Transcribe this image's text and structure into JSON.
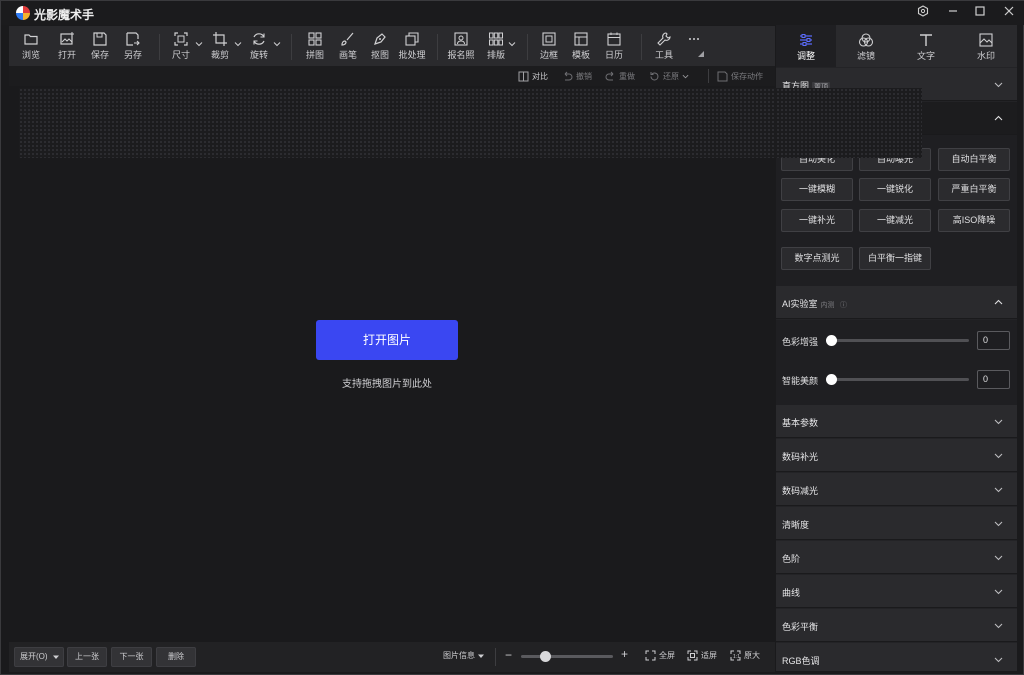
{
  "app": {
    "title": "光影魔术手"
  },
  "toolbar": {
    "browse": "浏览",
    "open": "打开",
    "save": "保存",
    "save_as": "另存",
    "size": "尺寸",
    "crop": "裁剪",
    "rotate": "旋转",
    "collage": "拼图",
    "brush": "画笔",
    "cutout": "抠图",
    "batch": "批处理",
    "id_photo": "报名照",
    "layout": "排版",
    "border": "边框",
    "template": "模板",
    "calendar": "日历",
    "tools": "工具"
  },
  "subbar": {
    "compare": "对比",
    "undo": "撤销",
    "redo": "重做",
    "restore": "还原",
    "save_action": "保存动作"
  },
  "canvas": {
    "open_image_button": "打开图片",
    "drag_hint": "支持拖拽图片到此处"
  },
  "bottombar": {
    "expand": "展开(O)",
    "prev": "上一张",
    "next": "下一张",
    "delete": "删除",
    "image_info": "图片信息",
    "fullscreen": "全屏",
    "fit_screen": "适屏",
    "original_size": "原大",
    "zoom_level": 0.27
  },
  "right_panel": {
    "tabs": [
      "调整",
      "滤镜",
      "文字",
      "水印"
    ],
    "active_tab": "调整",
    "histogram": {
      "label": "直方图",
      "tag": "置顶"
    },
    "auto_buttons": [
      "自动美化",
      "自动曝光",
      "自动白平衡",
      "一键模糊",
      "一键锐化",
      "严重白平衡",
      "一键补光",
      "一键减光",
      "高ISO降噪",
      "数字点测光",
      "白平衡一指键"
    ],
    "ai_lab": {
      "label": "AI实验室",
      "sub": "内测"
    },
    "sliders": [
      {
        "label": "色彩增强",
        "value": "0"
      },
      {
        "label": "智能美颜",
        "value": "0"
      }
    ],
    "sections": [
      "基本参数",
      "数码补光",
      "数码减光",
      "清晰度",
      "色阶",
      "曲线",
      "色彩平衡",
      "RGB色调"
    ]
  },
  "colors": {
    "accent": "#3a47f2",
    "background": "#1a1a1c",
    "panel": "#2a2a2d"
  }
}
